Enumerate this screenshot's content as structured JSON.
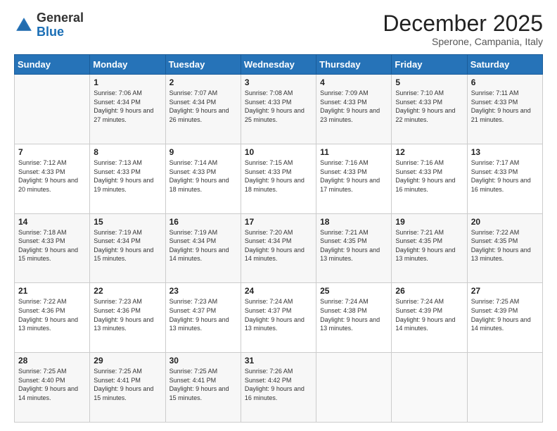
{
  "header": {
    "logo_general": "General",
    "logo_blue": "Blue",
    "month_title": "December 2025",
    "location": "Sperone, Campania, Italy"
  },
  "weekdays": [
    "Sunday",
    "Monday",
    "Tuesday",
    "Wednesday",
    "Thursday",
    "Friday",
    "Saturday"
  ],
  "weeks": [
    [
      {
        "day": "",
        "sunrise": "",
        "sunset": "",
        "daylight": ""
      },
      {
        "day": "1",
        "sunrise": "Sunrise: 7:06 AM",
        "sunset": "Sunset: 4:34 PM",
        "daylight": "Daylight: 9 hours and 27 minutes."
      },
      {
        "day": "2",
        "sunrise": "Sunrise: 7:07 AM",
        "sunset": "Sunset: 4:34 PM",
        "daylight": "Daylight: 9 hours and 26 minutes."
      },
      {
        "day": "3",
        "sunrise": "Sunrise: 7:08 AM",
        "sunset": "Sunset: 4:33 PM",
        "daylight": "Daylight: 9 hours and 25 minutes."
      },
      {
        "day": "4",
        "sunrise": "Sunrise: 7:09 AM",
        "sunset": "Sunset: 4:33 PM",
        "daylight": "Daylight: 9 hours and 23 minutes."
      },
      {
        "day": "5",
        "sunrise": "Sunrise: 7:10 AM",
        "sunset": "Sunset: 4:33 PM",
        "daylight": "Daylight: 9 hours and 22 minutes."
      },
      {
        "day": "6",
        "sunrise": "Sunrise: 7:11 AM",
        "sunset": "Sunset: 4:33 PM",
        "daylight": "Daylight: 9 hours and 21 minutes."
      }
    ],
    [
      {
        "day": "7",
        "sunrise": "Sunrise: 7:12 AM",
        "sunset": "Sunset: 4:33 PM",
        "daylight": "Daylight: 9 hours and 20 minutes."
      },
      {
        "day": "8",
        "sunrise": "Sunrise: 7:13 AM",
        "sunset": "Sunset: 4:33 PM",
        "daylight": "Daylight: 9 hours and 19 minutes."
      },
      {
        "day": "9",
        "sunrise": "Sunrise: 7:14 AM",
        "sunset": "Sunset: 4:33 PM",
        "daylight": "Daylight: 9 hours and 18 minutes."
      },
      {
        "day": "10",
        "sunrise": "Sunrise: 7:15 AM",
        "sunset": "Sunset: 4:33 PM",
        "daylight": "Daylight: 9 hours and 18 minutes."
      },
      {
        "day": "11",
        "sunrise": "Sunrise: 7:16 AM",
        "sunset": "Sunset: 4:33 PM",
        "daylight": "Daylight: 9 hours and 17 minutes."
      },
      {
        "day": "12",
        "sunrise": "Sunrise: 7:16 AM",
        "sunset": "Sunset: 4:33 PM",
        "daylight": "Daylight: 9 hours and 16 minutes."
      },
      {
        "day": "13",
        "sunrise": "Sunrise: 7:17 AM",
        "sunset": "Sunset: 4:33 PM",
        "daylight": "Daylight: 9 hours and 16 minutes."
      }
    ],
    [
      {
        "day": "14",
        "sunrise": "Sunrise: 7:18 AM",
        "sunset": "Sunset: 4:33 PM",
        "daylight": "Daylight: 9 hours and 15 minutes."
      },
      {
        "day": "15",
        "sunrise": "Sunrise: 7:19 AM",
        "sunset": "Sunset: 4:34 PM",
        "daylight": "Daylight: 9 hours and 15 minutes."
      },
      {
        "day": "16",
        "sunrise": "Sunrise: 7:19 AM",
        "sunset": "Sunset: 4:34 PM",
        "daylight": "Daylight: 9 hours and 14 minutes."
      },
      {
        "day": "17",
        "sunrise": "Sunrise: 7:20 AM",
        "sunset": "Sunset: 4:34 PM",
        "daylight": "Daylight: 9 hours and 14 minutes."
      },
      {
        "day": "18",
        "sunrise": "Sunrise: 7:21 AM",
        "sunset": "Sunset: 4:35 PM",
        "daylight": "Daylight: 9 hours and 13 minutes."
      },
      {
        "day": "19",
        "sunrise": "Sunrise: 7:21 AM",
        "sunset": "Sunset: 4:35 PM",
        "daylight": "Daylight: 9 hours and 13 minutes."
      },
      {
        "day": "20",
        "sunrise": "Sunrise: 7:22 AM",
        "sunset": "Sunset: 4:35 PM",
        "daylight": "Daylight: 9 hours and 13 minutes."
      }
    ],
    [
      {
        "day": "21",
        "sunrise": "Sunrise: 7:22 AM",
        "sunset": "Sunset: 4:36 PM",
        "daylight": "Daylight: 9 hours and 13 minutes."
      },
      {
        "day": "22",
        "sunrise": "Sunrise: 7:23 AM",
        "sunset": "Sunset: 4:36 PM",
        "daylight": "Daylight: 9 hours and 13 minutes."
      },
      {
        "day": "23",
        "sunrise": "Sunrise: 7:23 AM",
        "sunset": "Sunset: 4:37 PM",
        "daylight": "Daylight: 9 hours and 13 minutes."
      },
      {
        "day": "24",
        "sunrise": "Sunrise: 7:24 AM",
        "sunset": "Sunset: 4:37 PM",
        "daylight": "Daylight: 9 hours and 13 minutes."
      },
      {
        "day": "25",
        "sunrise": "Sunrise: 7:24 AM",
        "sunset": "Sunset: 4:38 PM",
        "daylight": "Daylight: 9 hours and 13 minutes."
      },
      {
        "day": "26",
        "sunrise": "Sunrise: 7:24 AM",
        "sunset": "Sunset: 4:39 PM",
        "daylight": "Daylight: 9 hours and 14 minutes."
      },
      {
        "day": "27",
        "sunrise": "Sunrise: 7:25 AM",
        "sunset": "Sunset: 4:39 PM",
        "daylight": "Daylight: 9 hours and 14 minutes."
      }
    ],
    [
      {
        "day": "28",
        "sunrise": "Sunrise: 7:25 AM",
        "sunset": "Sunset: 4:40 PM",
        "daylight": "Daylight: 9 hours and 14 minutes."
      },
      {
        "day": "29",
        "sunrise": "Sunrise: 7:25 AM",
        "sunset": "Sunset: 4:41 PM",
        "daylight": "Daylight: 9 hours and 15 minutes."
      },
      {
        "day": "30",
        "sunrise": "Sunrise: 7:25 AM",
        "sunset": "Sunset: 4:41 PM",
        "daylight": "Daylight: 9 hours and 15 minutes."
      },
      {
        "day": "31",
        "sunrise": "Sunrise: 7:26 AM",
        "sunset": "Sunset: 4:42 PM",
        "daylight": "Daylight: 9 hours and 16 minutes."
      },
      {
        "day": "",
        "sunrise": "",
        "sunset": "",
        "daylight": ""
      },
      {
        "day": "",
        "sunrise": "",
        "sunset": "",
        "daylight": ""
      },
      {
        "day": "",
        "sunrise": "",
        "sunset": "",
        "daylight": ""
      }
    ]
  ]
}
